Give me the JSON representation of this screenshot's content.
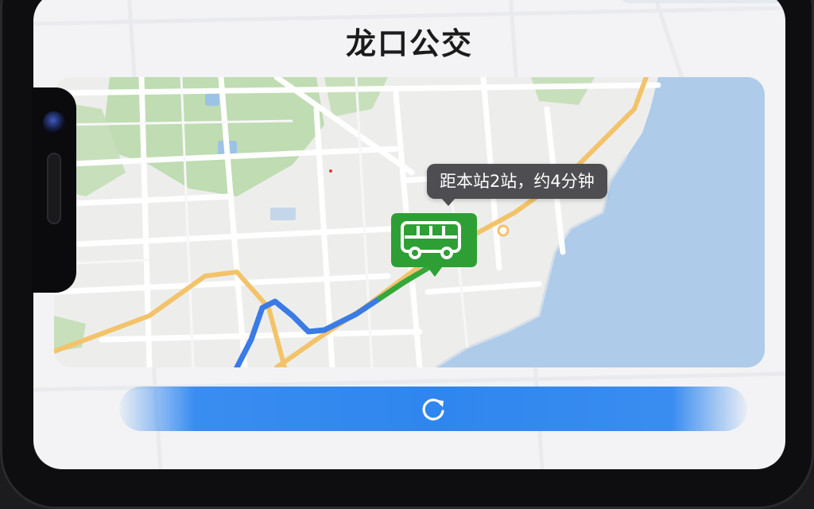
{
  "app": {
    "title": "龙口公交"
  },
  "map": {
    "tooltip_text": "距本站2站，约4分钟",
    "marker_icon": "bus-icon",
    "route_color": "#3a7be6",
    "bus_color": "#35a83a",
    "sea_color": "#aecbea"
  },
  "controls": {
    "refresh_icon": "refresh-icon",
    "refresh_color": "#2f86ee"
  }
}
